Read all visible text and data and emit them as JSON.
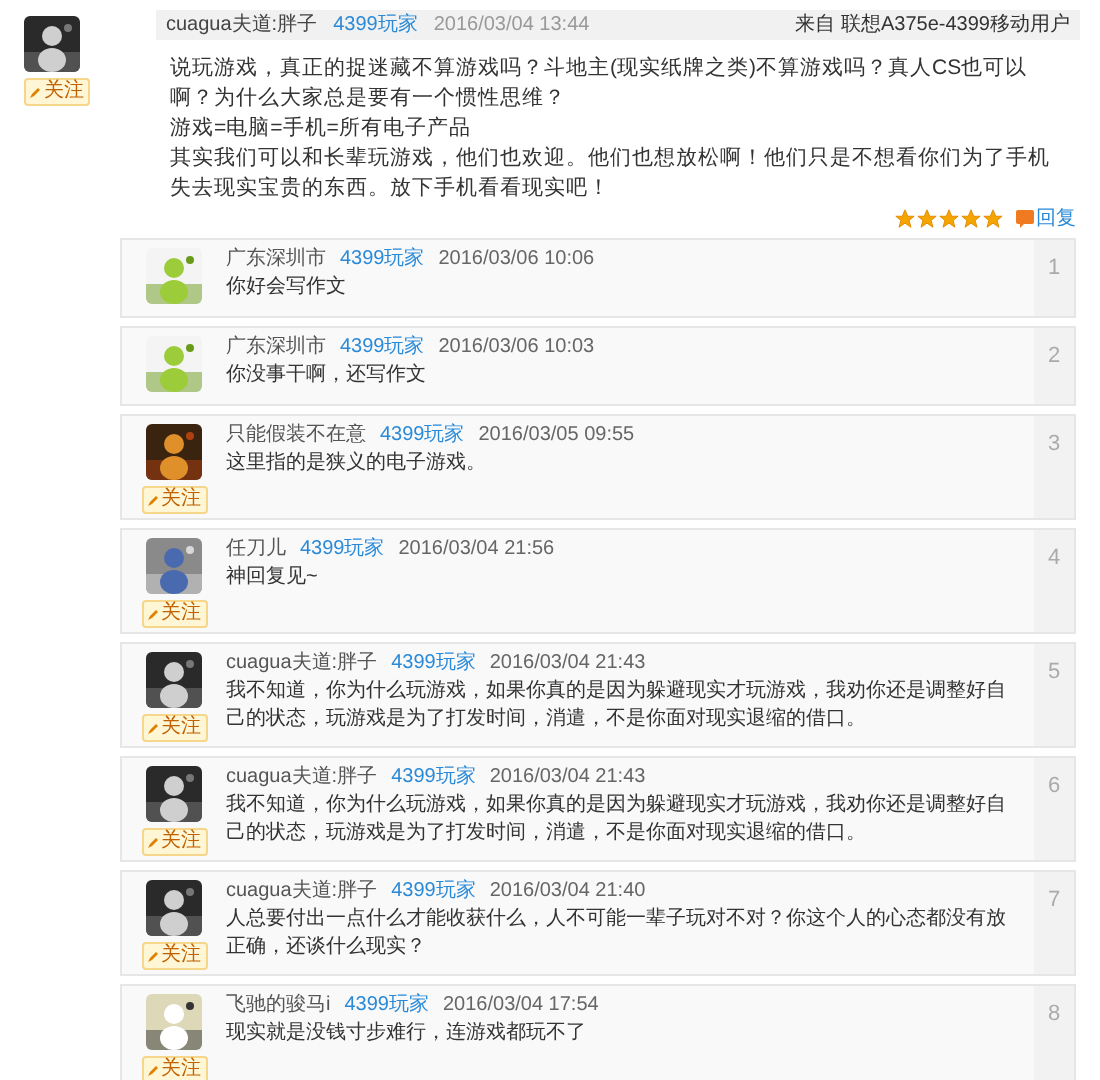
{
  "post": {
    "author": "cuagua夫道:胖子",
    "role": "4399玩家",
    "time": "2016/03/04 13:44",
    "source": "来自 联想A375e-4399移动用户",
    "follow": "关注",
    "paragraphs": [
      "说玩游戏，真正的捉迷藏不算游戏吗？斗地主(现实纸牌之类)不算游戏吗？真人CS也可以啊？为什么大家总是要有一个惯性思维？",
      "游戏=电脑=手机=所有电子产品",
      "其实我们可以和长辈玩游戏，他们也欢迎。他们也想放松啊！他们只是不想看你们为了手机失去现实宝贵的东西。放下手机看看现实吧！"
    ],
    "stars": 5,
    "reply_label": "回复"
  },
  "replies": [
    {
      "number": "1",
      "author": "广东深圳市",
      "role": "4399玩家",
      "time": "2016/03/06 10:06",
      "text": "你好会写作文"
    },
    {
      "number": "2",
      "author": "广东深圳市",
      "role": "4399玩家",
      "time": "2016/03/06 10:03",
      "text": "你没事干啊，还写作文"
    },
    {
      "number": "3",
      "author": "只能假装不在意",
      "role": "4399玩家",
      "time": "2016/03/05 09:55",
      "text": "这里指的是狭义的电子游戏。",
      "follow": "关注"
    },
    {
      "number": "4",
      "author": "任刀儿",
      "role": "4399玩家",
      "time": "2016/03/04 21:56",
      "text": "神回复见~",
      "follow": "关注"
    },
    {
      "number": "5",
      "author": "cuagua夫道:胖子",
      "role": "4399玩家",
      "time": "2016/03/04 21:43",
      "text": "我不知道，你为什么玩游戏，如果你真的是因为躲避现实才玩游戏，我劝你还是调整好自己的状态，玩游戏是为了打发时间，消遣，不是你面对现实退缩的借口。",
      "follow": "关注"
    },
    {
      "number": "6",
      "author": "cuagua夫道:胖子",
      "role": "4399玩家",
      "time": "2016/03/04 21:43",
      "text": "我不知道，你为什么玩游戏，如果你真的是因为躲避现实才玩游戏，我劝你还是调整好自己的状态，玩游戏是为了打发时间，消遣，不是你面对现实退缩的借口。",
      "follow": "关注"
    },
    {
      "number": "7",
      "author": "cuagua夫道:胖子",
      "role": "4399玩家",
      "time": "2016/03/04 21:40",
      "text": "人总要付出一点什么才能收获什么，人不可能一辈子玩对不对？你这个人的心态都没有放正确，还谈什么现实？",
      "follow": "关注"
    },
    {
      "number": "8",
      "author": "飞驰的骏马i",
      "role": "4399玩家",
      "time": "2016/03/04 17:54",
      "text": "现实就是没钱寸步难行，连游戏都玩不了",
      "follow": "关注"
    }
  ]
}
